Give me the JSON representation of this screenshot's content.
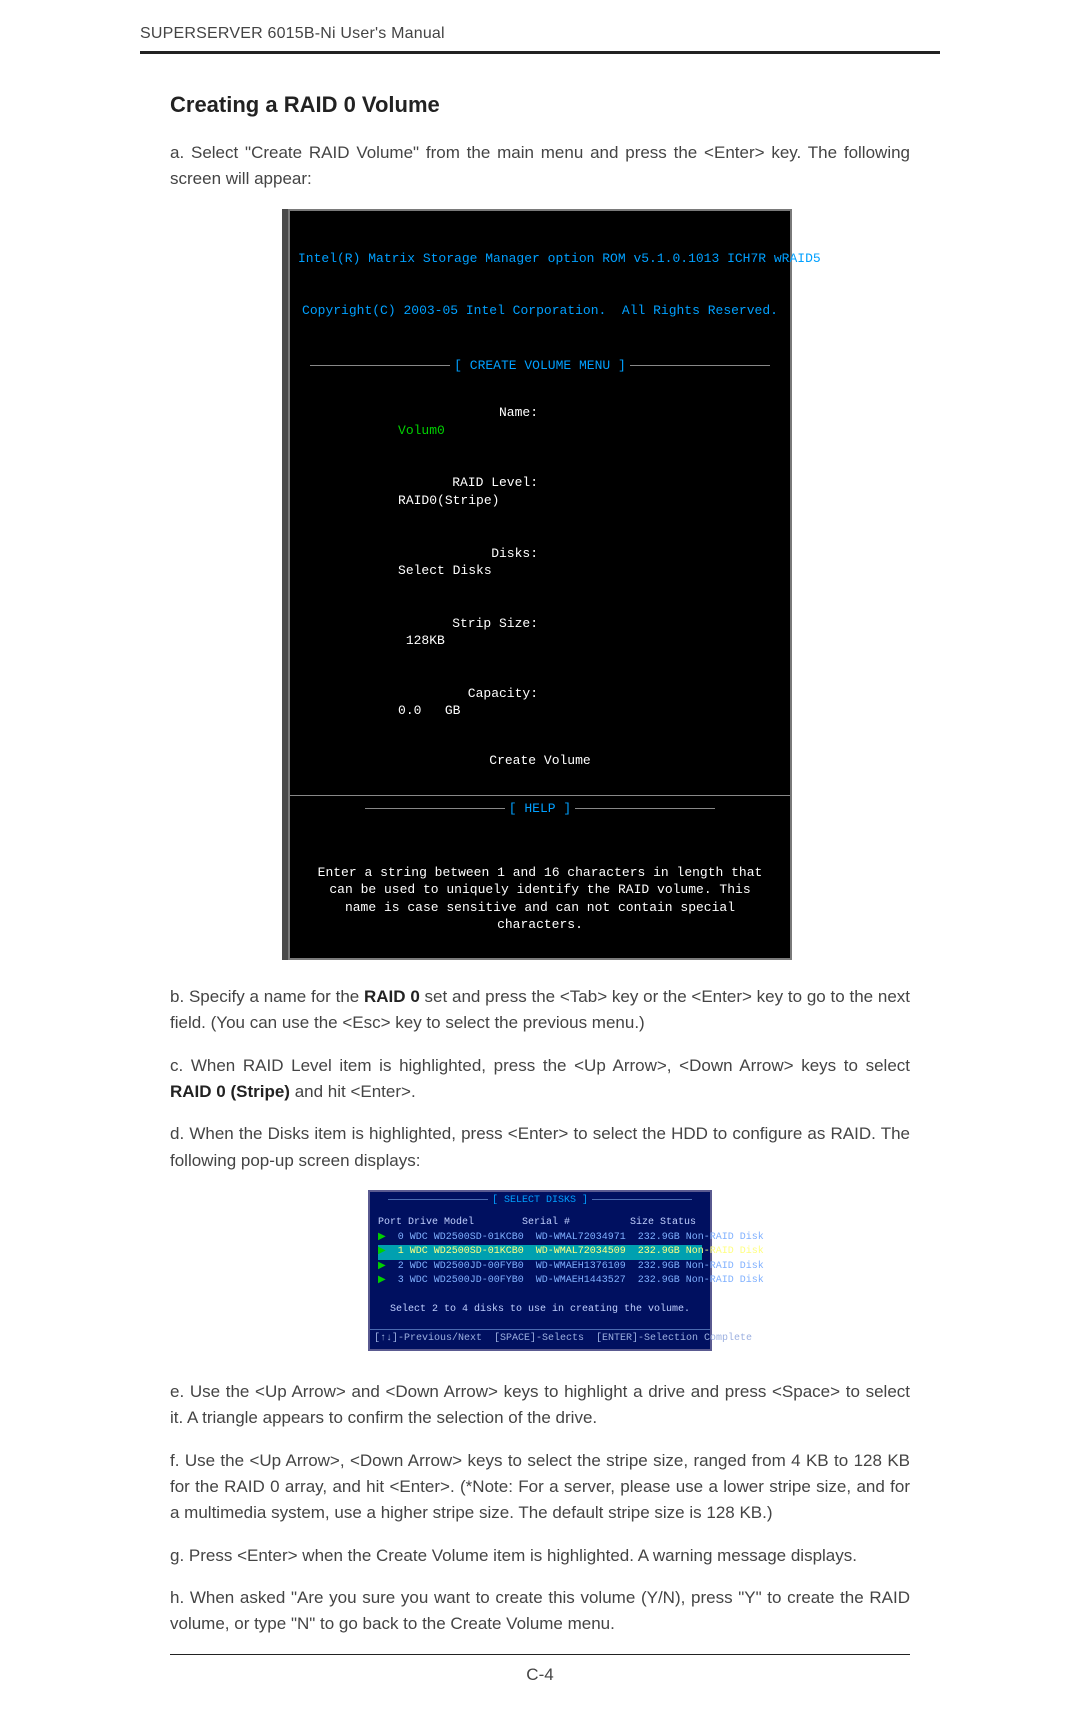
{
  "running_head": "SUPERSERVER 6015B-Ni User's Manual",
  "section_heading": "Creating a RAID 0 Volume",
  "para_a": "a. Select \"Create RAID Volume\" from the main menu and press the <Enter> key. The following screen will appear:",
  "bios1": {
    "title_line1": "Intel(R) Matrix Storage Manager option ROM v5.1.0.1013 ICH7R wRAID5",
    "title_line2": "Copyright(C) 2003-05 Intel Corporation.  All Rights Reserved.",
    "menu_label": "[ CREATE VOLUME MENU ]",
    "fields": {
      "name_label": "Name:",
      "name_value": "Volum0",
      "raid_label": "RAID Level:",
      "raid_value": "RAID0(Stripe)",
      "disks_label": "Disks:",
      "disks_value": "Select Disks",
      "strip_label": "Strip Size:",
      "strip_value": " 128KB",
      "cap_label": "Capacity:",
      "cap_value": "0.0   GB"
    },
    "create_label": "Create Volume",
    "help_label": "[ HELP ]",
    "help_text": "Enter a string between 1 and 16 characters in length that can be used to uniquely identify the RAID volume. This name is case sensitive and can not contain special characters."
  },
  "para_b_pre": "b. Specify a name for the ",
  "para_b_bold": "RAID 0",
  "para_b_post": " set and press the <Tab> key or the <Enter> key to go to the next field. (You can use the <Esc> key to select the previous menu.)",
  "para_c_pre": "c. When RAID Level item is highlighted, press the <Up Arrow>, <Down Arrow> keys to select ",
  "para_c_bold": "RAID 0 (Stripe)",
  "para_c_post": " and hit <Enter>.",
  "para_d": "d. When the Disks item is highlighted, press <Enter> to select the HDD to configure as RAID.  The following pop-up screen displays:",
  "disks": {
    "title": "[ SELECT DISKS ]",
    "header": "Port Drive Model        Serial #          Size Status",
    "rows": [
      "  0 WDC WD2500SD-01KCB0  WD-WMAL72034971  232.9GB Non-RAID Disk",
      "  1 WDC WD2500SD-01KCB0  WD-WMAL72034509  232.9GB Non-RAID Disk",
      "  2 WDC WD2500JD-00FYB0  WD-WMAEH1376109  232.9GB Non-RAID Disk",
      "  3 WDC WD2500JD-00FYB0  WD-WMAEH1443527  232.9GB Non-RAID Disk"
    ],
    "selected_index": 1,
    "note": "Select 2 to 4 disks to use in creating the volume.",
    "footer": "[↑↓]-Previous/Next  [SPACE]-Selects  [ENTER]-Selection Complete"
  },
  "para_e": "e. Use  the <Up Arrow> and <Down Arrow> keys to highlight a drive and press <Space> to select it. A triangle appears to confirm the selection of the drive.",
  "para_f": "f. Use  the <Up Arrow>, <Down Arrow> keys to select the stripe size, ranged from 4 KB to 128 KB for the RAID 0 array, and hit <Enter>. (*Note: For a server, please use a lower stripe size, and for a multimedia system, use a higher stripe size. The default stripe size is 128 KB.)",
  "para_g": "g. Press <Enter> when the Create Volume item is highlighted. A warning message displays.",
  "para_h": "h. When asked \"Are you sure you want to create this volume (Y/N), press \"Y\" to create the RAID volume, or type \"N\" to go back to the Create Volume menu.",
  "page_number": "C-4"
}
